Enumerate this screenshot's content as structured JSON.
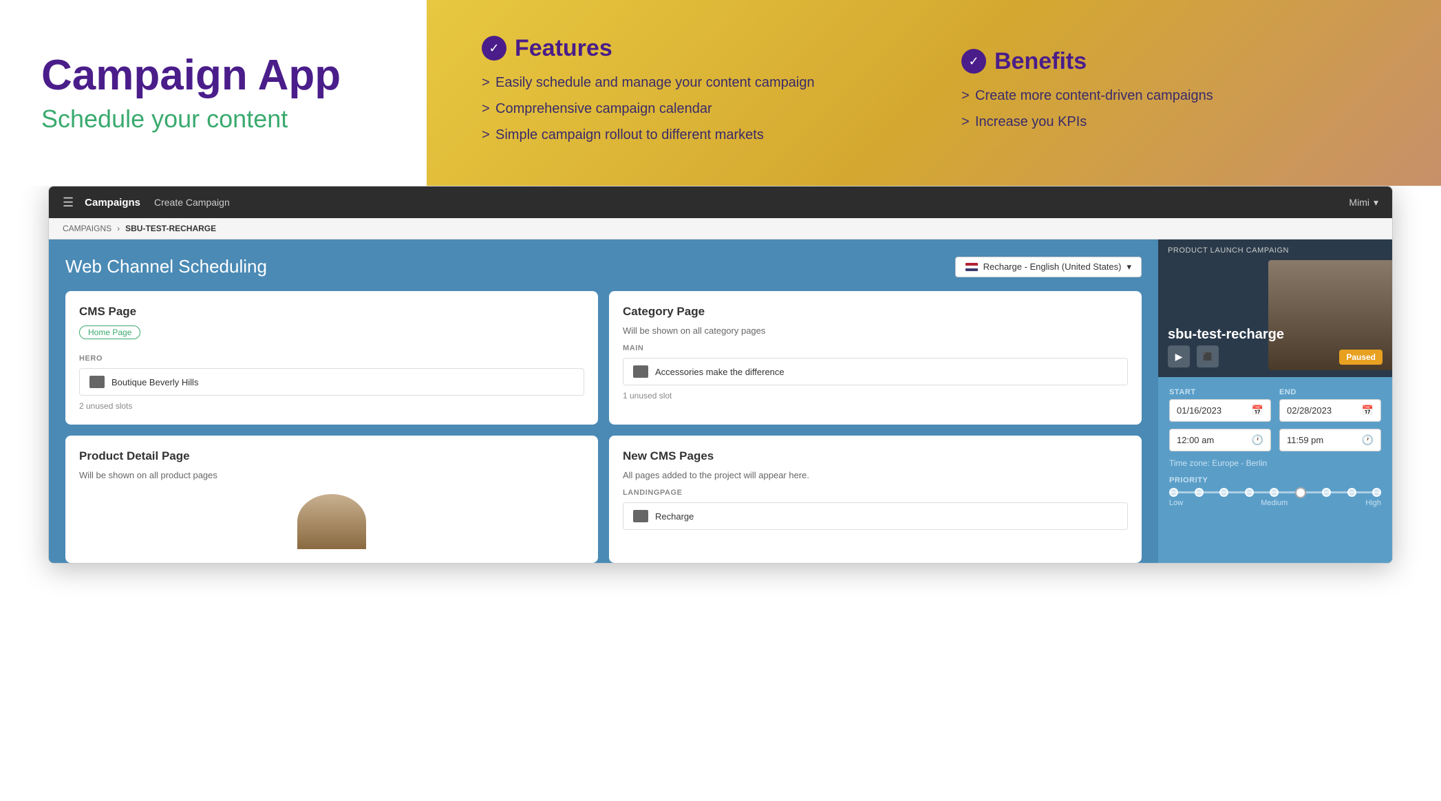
{
  "hero": {
    "title": "Campaign App",
    "subtitle": "Schedule your content"
  },
  "features": {
    "title": "Features",
    "items": [
      "Easily schedule and manage your content campaign",
      "Comprehensive campaign calendar",
      "Simple campaign rollout to different markets"
    ]
  },
  "benefits": {
    "title": "Benefits",
    "items": [
      "Create more content-driven campaigns",
      "Increase you KPIs"
    ]
  },
  "navbar": {
    "menu_icon": "☰",
    "brand": "Campaigns",
    "create_link": "Create Campaign",
    "user": "Mimi",
    "chevron": "▾"
  },
  "breadcrumb": {
    "parent": "CAMPAIGNS",
    "separator": "›",
    "current": "SBU-TEST-RECHARGE"
  },
  "main": {
    "title": "Web Channel Scheduling",
    "campaign_selector": "Recharge - English (United States)"
  },
  "cms_card": {
    "title": "CMS Page",
    "tag": "Home Page",
    "hero_label": "HERO",
    "hero_item": "Boutique Beverly Hills",
    "unused_slots": "2 unused slots"
  },
  "category_card": {
    "title": "Category Page",
    "subtitle": "Will be shown on all category pages",
    "main_label": "MAIN",
    "main_item": "Accessories make the difference",
    "unused_slots": "1 unused slot"
  },
  "product_card": {
    "title": "Product Detail Page",
    "subtitle": "Will be shown on all product pages"
  },
  "new_cms_card": {
    "title": "New CMS Pages",
    "subtitle": "All pages added to the project will appear here.",
    "landing_label": "LANDINGPAGE",
    "landing_item": "Recharge"
  },
  "video_panel": {
    "label": "PRODUCT LAUNCH CAMPAIGN",
    "campaign_name": "sbu-test-recharge",
    "paused": "Paused"
  },
  "schedule": {
    "start_label": "START",
    "end_label": "END",
    "start_date": "01/16/2023",
    "end_date": "02/28/2023",
    "start_time": "12:00 am",
    "end_time": "11:59 pm",
    "timezone": "Time zone: Europe - Berlin",
    "priority_label": "PRIORITY",
    "priority_low": "Low",
    "priority_medium": "Medium",
    "priority_high": "High"
  }
}
